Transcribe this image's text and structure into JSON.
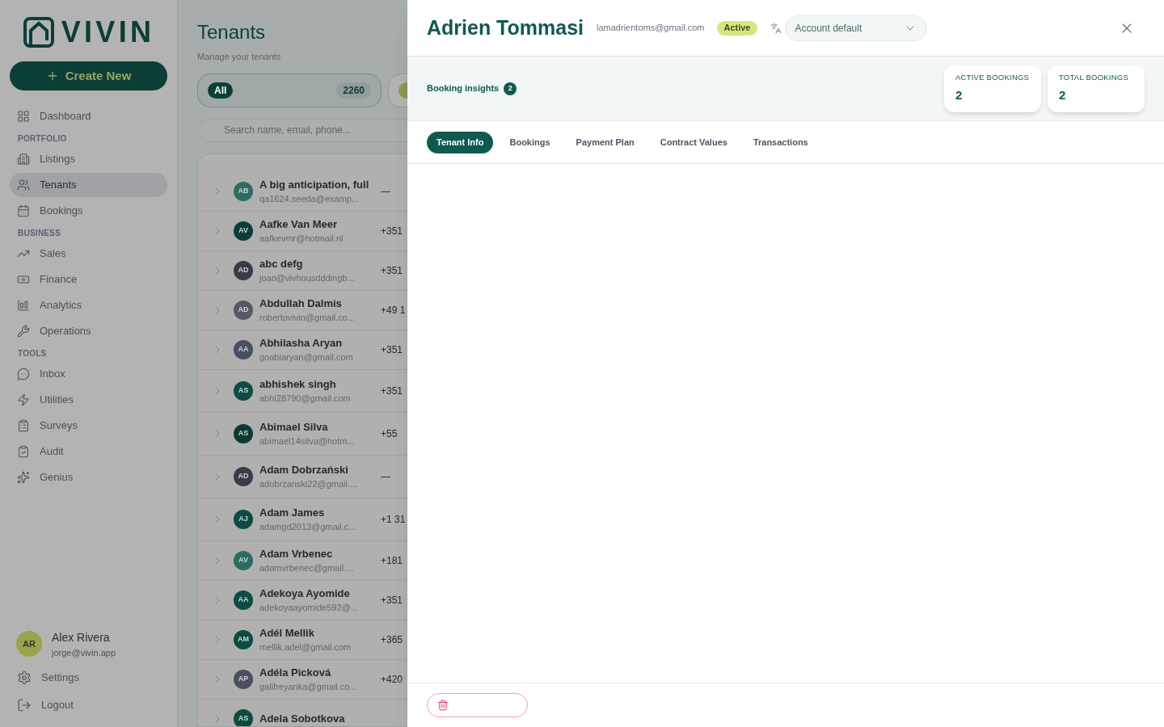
{
  "sidebar": {
    "logo": "VIVIN",
    "create_button": "Create New",
    "nav": [
      {
        "kind": "item",
        "label": "Dashboard",
        "selected": false
      },
      {
        "kind": "section",
        "label": "PORTFOLIO"
      },
      {
        "kind": "item",
        "label": "Listings",
        "selected": false
      },
      {
        "kind": "item",
        "label": "Tenants",
        "selected": true
      },
      {
        "kind": "item",
        "label": "Bookings",
        "selected": false
      },
      {
        "kind": "section",
        "label": "BUSINESS"
      },
      {
        "kind": "item",
        "label": "Sales",
        "selected": false
      },
      {
        "kind": "item",
        "label": "Finance",
        "selected": false
      },
      {
        "kind": "item",
        "label": "Analytics",
        "selected": false
      },
      {
        "kind": "item",
        "label": "Operations",
        "selected": false
      },
      {
        "kind": "section",
        "label": "TOOLS"
      },
      {
        "kind": "item",
        "label": "Inbox",
        "selected": false
      },
      {
        "kind": "item",
        "label": "Utilities",
        "selected": false
      },
      {
        "kind": "item",
        "label": "Surveys",
        "selected": false
      },
      {
        "kind": "item",
        "label": "Audit",
        "selected": false
      },
      {
        "kind": "item",
        "label": "Genius",
        "selected": false
      }
    ],
    "user": {
      "initials": "AR",
      "name": "Alex Rivera",
      "email": "jorge@vivin.app"
    },
    "footer": [
      {
        "label": "Settings"
      },
      {
        "label": "Logout"
      }
    ]
  },
  "main": {
    "title": "Tenants",
    "subtitle": "Manage your tenants",
    "filters": [
      {
        "label": "All",
        "count": "2260",
        "selected": true
      },
      {
        "selected": false
      }
    ],
    "search": {
      "placeholder": "Search name, email, phone..."
    },
    "tenants": [
      {
        "initials": "AB",
        "name": "A big anticipation, full",
        "email": "qa1624.seeda@examp...",
        "phone": "—",
        "color": "#2b6d62"
      },
      {
        "initials": "AV",
        "name": "Aafke Van Meer",
        "email": "aafkevmr@hotmail.nl",
        "phone": "+351",
        "color": "#0a3f38"
      },
      {
        "initials": "AD",
        "name": "abc defg",
        "email": "joao@vivhousdddingb...",
        "phone": "+351",
        "color": "#373c47"
      },
      {
        "initials": "AD",
        "name": "Abdullah Dalmis",
        "email": "robertovivin@gmail.co...",
        "phone": "+49 1",
        "color": "#555a66"
      },
      {
        "initials": "AA",
        "name": "Abhilasha Aryan",
        "email": "goabiaryan@gmail.com",
        "phone": "+351",
        "color": "#474f60"
      },
      {
        "initials": "AS",
        "name": "abhishek singh",
        "email": "abhi28790@gmail.com",
        "phone": "+351",
        "color": "#0b4d43"
      },
      {
        "initials": "AS",
        "name": "Abimael Silva",
        "email": "abimael14silva@hotm...",
        "phone": "+55",
        "color": "#083b34"
      },
      {
        "initials": "AD",
        "name": "Adam Dobrzański",
        "email": "adobrzanski22@gmail....",
        "phone": "—",
        "color": "#373c47"
      },
      {
        "initials": "AJ",
        "name": "Adam James",
        "email": "adamgd2013@gmail.c...",
        "phone": "+1 31",
        "color": "#0b4d43"
      },
      {
        "initials": "AV",
        "name": "Adam Vrbenec",
        "email": "adamvrbenec@gmail....",
        "phone": "+181",
        "color": "#2b6d62"
      },
      {
        "initials": "AA",
        "name": "Adekoya Ayomide",
        "email": "adekoyaayomide592@...",
        "phone": "+351",
        "color": "#0b4d43"
      },
      {
        "initials": "AM",
        "name": "Adél Mellik",
        "email": "mellik.adel@gmail.com",
        "phone": "+365",
        "color": "#0b4d43"
      },
      {
        "initials": "AP",
        "name": "Adéla Picková",
        "email": "galifreyanka@gmail.co...",
        "phone": "+420",
        "color": "#474f60"
      },
      {
        "initials": "AS",
        "name": "Adela Sobotkova",
        "color": "#0b4d43"
      }
    ]
  },
  "drawer": {
    "name": "Adrien Tommasi",
    "email": "lamadrientoms@gmail.com",
    "status": "Active",
    "language_select": {
      "value": "Account default"
    },
    "insights": {
      "label": "Booking insights",
      "count": "2"
    },
    "stats": [
      {
        "label": "ACTIVE BOOKINGS",
        "value": "2"
      },
      {
        "label": "TOTAL BOOKINGS",
        "value": "2"
      }
    ],
    "tabs": [
      {
        "label": "Tenant Info",
        "selected": true
      },
      {
        "label": "Bookings",
        "selected": false
      },
      {
        "label": "Payment Plan",
        "selected": false
      },
      {
        "label": "Contract Values",
        "selected": false
      },
      {
        "label": "Transactions",
        "selected": false
      }
    ]
  }
}
